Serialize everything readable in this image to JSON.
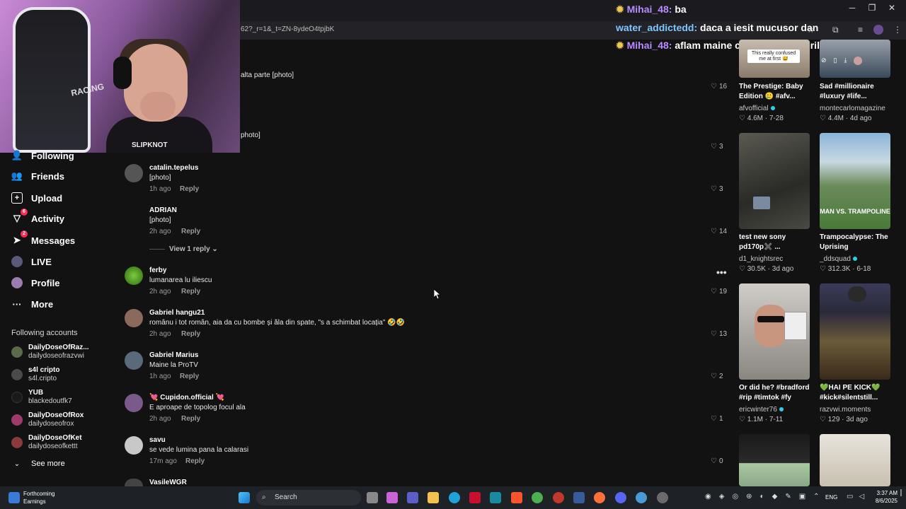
{
  "browser": {
    "url_fragment": "62?_r=1&_t=ZN-8ydeO4tpjbK",
    "controls": {
      "minimize": "─",
      "restore": "❐",
      "close": "✕"
    }
  },
  "chat": [
    {
      "user": "Mihai_48:",
      "message": "ba"
    },
    {
      "user": "water_addictedd:",
      "message": "daca a iesit mucusor dan"
    },
    {
      "user": "Mihai_48:",
      "message": "aflam maine cand o apara stirile"
    }
  ],
  "webcam": {
    "chair_brand": "RACING",
    "shirt_text": "SLIPKNOT"
  },
  "partial_comments": [
    {
      "text": "alta parte [photo]",
      "likes": "16"
    },
    {
      "text": "photo]",
      "likes": "3"
    }
  ],
  "sidebar": {
    "items": [
      {
        "label": "Following",
        "icon": "following-icon"
      },
      {
        "label": "Friends",
        "icon": "friends-icon"
      },
      {
        "label": "Upload",
        "icon": "upload-icon"
      },
      {
        "label": "Activity",
        "icon": "activity-icon",
        "badge": "6"
      },
      {
        "label": "Messages",
        "icon": "messages-icon",
        "badge": "2"
      },
      {
        "label": "LIVE",
        "icon": "live-icon"
      },
      {
        "label": "Profile",
        "icon": "profile-icon"
      },
      {
        "label": "More",
        "icon": "more-icon"
      }
    ],
    "following_title": "Following accounts",
    "accounts": [
      {
        "name": "DailyDoseOfRaz...",
        "handle": "dailydoseofrazvwi"
      },
      {
        "name": "s4l cripto",
        "handle": "s4l.cripto"
      },
      {
        "name": "YUB",
        "handle": "blackedoutfk7"
      },
      {
        "name": "DailyDoseOfRox",
        "handle": "dailydoseofrox"
      },
      {
        "name": "DailyDoseOfKet",
        "handle": "dailydoseofkettt"
      }
    ],
    "see_more": "See more"
  },
  "comments": [
    {
      "user": "catalin.tepelus",
      "text": "[photo]",
      "time": "1h ago",
      "reply": "Reply",
      "likes": "3"
    },
    {
      "user": "ADRIAN",
      "text": "[photo]",
      "time": "2h ago",
      "reply": "Reply",
      "likes": "14"
    },
    {
      "user": "ferby",
      "text": "lumanarea lu iliescu",
      "time": "2h ago",
      "reply": "Reply",
      "likes": "19"
    },
    {
      "user": "Gabriel hangu21",
      "text": "românu i tot român, aia da cu bombe și ăla din spate, \"s a schimbat locația\" 🤣🤣",
      "time": "2h ago",
      "reply": "Reply",
      "likes": "13"
    },
    {
      "user": "Gabriel Marius",
      "text": "Maine la ProTV",
      "time": "1h ago",
      "reply": "Reply",
      "likes": "2"
    },
    {
      "user": "💘 Cupidon.official 💘",
      "text": "E aproape de topolog focul ala",
      "time": "2h ago",
      "reply": "Reply",
      "likes": "1"
    },
    {
      "user": "savu",
      "text": "se vede lumina pana la calarasi",
      "time": "17m ago",
      "reply": "Reply",
      "likes": "0"
    },
    {
      "user": "VasileWGR",
      "text": "",
      "time": "",
      "reply": "",
      "likes": ""
    }
  ],
  "view_replies": "View 1 reply",
  "more_dots": "•••",
  "videos": [
    {
      "title": "The Prestige: Baby Edition 🥲 #afv...",
      "author": "afvofficial",
      "views": "4.6M",
      "date": "7-28",
      "overlay": "This really confused me at first 😅",
      "verified": true
    },
    {
      "title": "Sad #millionaire #luxury #life...",
      "author": "montecarlomagazine",
      "views": "4.4M",
      "date": "4d ago",
      "overlay": "",
      "verified": false
    },
    {
      "title": "test new sony pd170p✖️ ...",
      "author": "d1_knightsrec",
      "views": "30.5K",
      "date": "3d ago",
      "overlay": "",
      "verified": false
    },
    {
      "title": "Trampocalypse: The Uprising",
      "author": "_ddsquad",
      "views": "312.3K",
      "date": "6-18",
      "overlay": "MAN VS. TRAMPOLINE",
      "verified": true
    },
    {
      "title": "Or did he? #bradford #rip #timtok #fy",
      "author": "ericwinter76",
      "views": "1.1M",
      "date": "7-11",
      "overlay": "",
      "verified": true
    },
    {
      "title": "💚HAI PE KICK💚 #kick#silentstill...",
      "author": "razvwi.moments",
      "views": "129",
      "date": "3d ago",
      "overlay": "",
      "verified": false
    }
  ],
  "taskbar": {
    "weather_title": "Forthcoming",
    "weather_sub": "Earnings",
    "search_placeholder": "Search",
    "lang": "ENG",
    "time": "3:37 AM",
    "date": "8/6/2025"
  }
}
